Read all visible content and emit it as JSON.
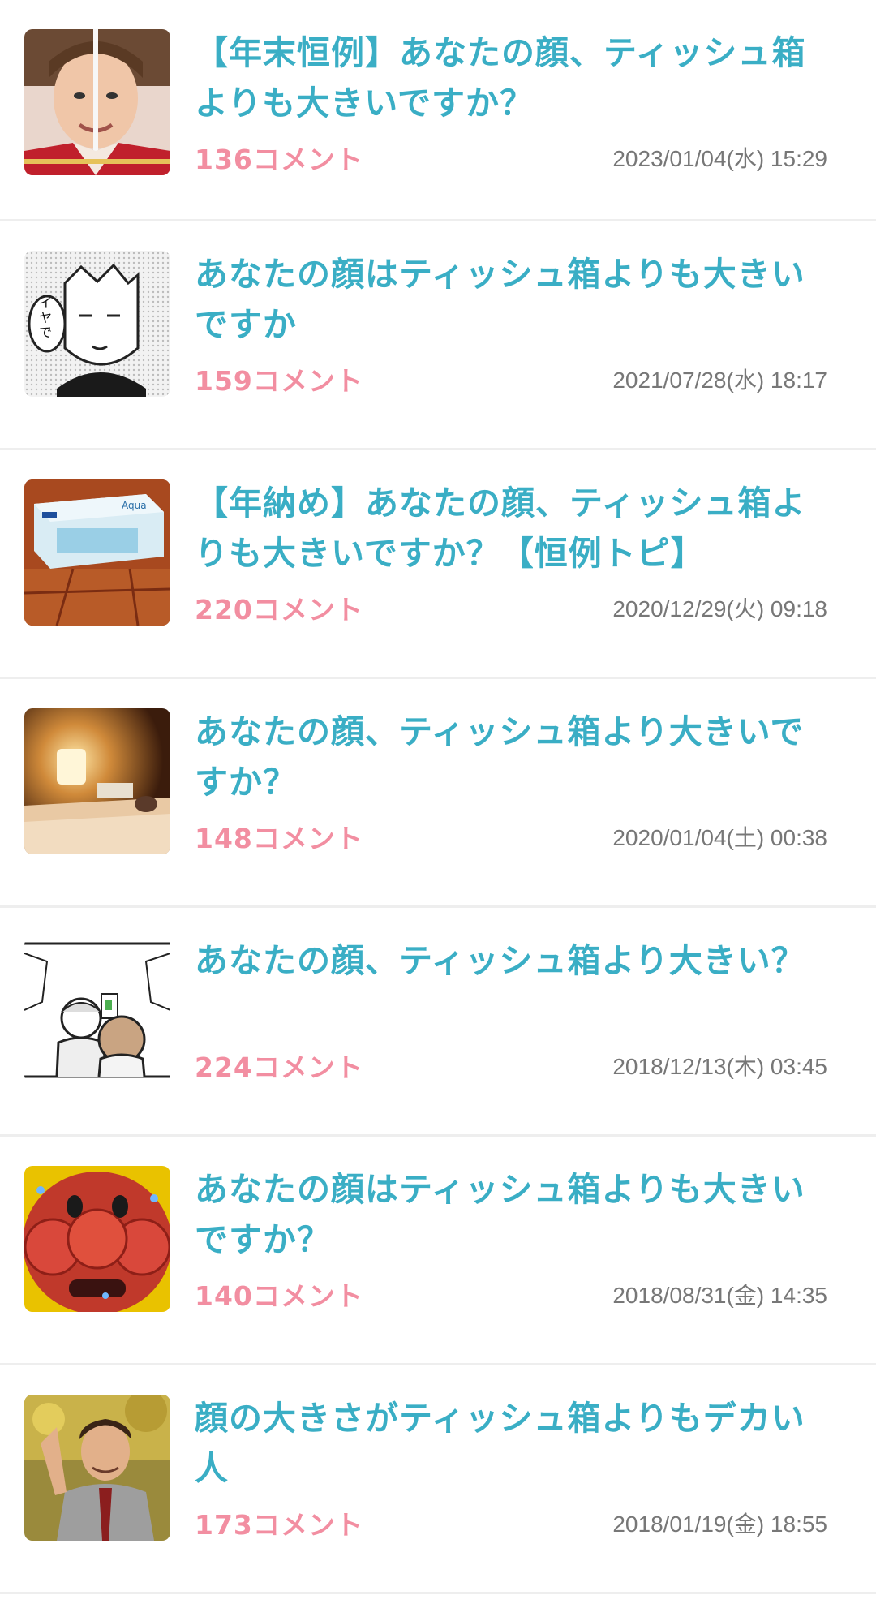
{
  "topics": [
    {
      "title": "【年末恒例】あなたの顔、ティッシュ箱よりも大きいですか？",
      "comments": "136コメント",
      "date": "2023/01/04(水) 15:29",
      "thumb": "woman-face-measure"
    },
    {
      "title": "あなたの顔はティッシュ箱よりも大きいですか",
      "comments": "159コメント",
      "date": "2021/07/28(水) 18:17",
      "thumb": "manga-character"
    },
    {
      "title": "【年納め】あなたの顔、ティッシュ箱よりも大きいですか？【恒例トピ】",
      "comments": "220コメント",
      "date": "2020/12/29(火) 09:18",
      "thumb": "tissue-box"
    },
    {
      "title": "あなたの顔、ティッシュ箱より大きいですか？",
      "comments": "148コメント",
      "date": "2020/01/04(土) 00:38",
      "thumb": "bedroom-lamp"
    },
    {
      "title": "あなたの顔、ティッシュ箱より大きい？",
      "comments": "224コメント",
      "date": "2018/12/13(木) 03:45",
      "thumb": "comic-panel"
    },
    {
      "title": "あなたの顔はティッシュ箱よりも大きいですか？",
      "comments": "140コメント",
      "date": "2018/08/31(金) 14:35",
      "thumb": "red-character-face"
    },
    {
      "title": "顔の大きさがティッシュ箱よりもデカい人",
      "comments": "173コメント",
      "date": "2018/01/19(金) 18:55",
      "thumb": "man-waving"
    }
  ],
  "colors": {
    "title": "#3aaec5",
    "comments": "#f28ea1",
    "date": "#777777",
    "divider": "#eeeeee"
  }
}
